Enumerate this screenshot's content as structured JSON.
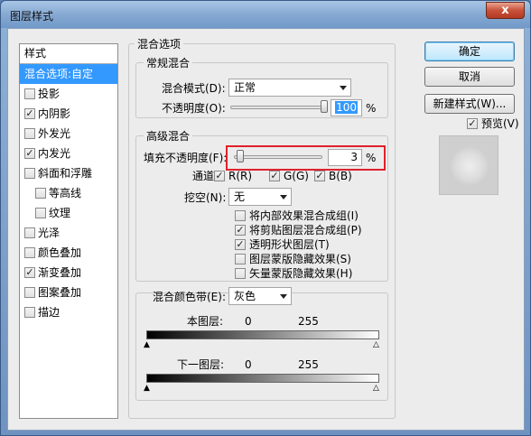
{
  "window": {
    "title": "图层样式",
    "close": "x"
  },
  "styles": {
    "header": "样式",
    "items": [
      {
        "label": "混合选项:自定",
        "selected": true
      },
      {
        "label": "投影",
        "checked": false
      },
      {
        "label": "内阴影",
        "checked": true
      },
      {
        "label": "外发光",
        "checked": false
      },
      {
        "label": "内发光",
        "checked": true
      },
      {
        "label": "斜面和浮雕",
        "checked": false
      },
      {
        "label": "等高线",
        "checked": false,
        "sub": true
      },
      {
        "label": "纹理",
        "checked": false,
        "sub": true
      },
      {
        "label": "光泽",
        "checked": false
      },
      {
        "label": "颜色叠加",
        "checked": false
      },
      {
        "label": "渐变叠加",
        "checked": true
      },
      {
        "label": "图案叠加",
        "checked": false
      },
      {
        "label": "描边",
        "checked": false
      }
    ]
  },
  "blend_options": {
    "title": "混合选项",
    "general": {
      "title": "常规混合",
      "mode_label": "混合模式(D):",
      "mode_value": "正常",
      "opacity_label": "不透明度(O):",
      "opacity_value": "100",
      "opacity_unit": "%",
      "opacity_fraction": 1.0
    },
    "advanced": {
      "title": "高级混合",
      "fill_label": "填充不透明度(F):",
      "fill_value": "3",
      "fill_unit": "%",
      "fill_fraction": 0.03,
      "channels_label": "通道:",
      "channels": [
        "R(R)",
        "G(G)",
        "B(B)"
      ],
      "knockout_label": "挖空(N):",
      "knockout_value": "无",
      "options": [
        {
          "label": "将内部效果混合成组(I)",
          "checked": false
        },
        {
          "label": "将剪贴图层混合成组(P)",
          "checked": true
        },
        {
          "label": "透明形状图层(T)",
          "checked": true
        },
        {
          "label": "图层蒙版隐藏效果(S)",
          "checked": false
        },
        {
          "label": "矢量蒙版隐藏效果(H)",
          "checked": false
        }
      ]
    },
    "blend_if": {
      "label": "混合颜色带(E):",
      "value": "灰色",
      "this_layer_label": "本图层:",
      "underlying_label": "下一图层:",
      "min": "0",
      "max": "255"
    }
  },
  "buttons": {
    "ok": "确定",
    "cancel": "取消",
    "new_style": "新建样式(W)...",
    "preview": "预览(V)",
    "preview_checked": true
  }
}
